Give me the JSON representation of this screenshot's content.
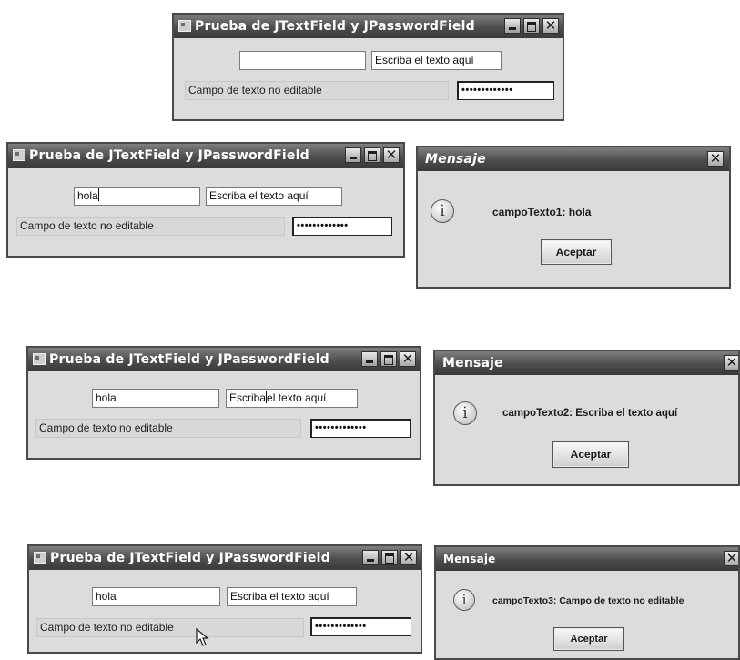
{
  "main_window": {
    "title": "Prueba de JTextField y JPasswordField",
    "empty_field": "",
    "hint_field": "Escriba el texto aquí",
    "noneditable_field": "Campo de texto no editable",
    "password_field": "•••••••••••••"
  },
  "window_2": {
    "title": "Prueba de JTextField y JPasswordField",
    "text_field": "hola",
    "hint_field": "Escriba el texto aquí",
    "noneditable_field": "Campo de texto no editable",
    "password_field": "•••••••••••••"
  },
  "dialog_1": {
    "title": "Mensaje",
    "info_icon": "i",
    "message": "campoTexto1: hola",
    "button": "Aceptar"
  },
  "window_3": {
    "title": "Prueba de JTextField y JPasswordField",
    "text_field": "hola",
    "hint_field_before_caret": "Escriba",
    "hint_field_after_caret": "el texto aquí",
    "noneditable_field": "Campo de texto no editable",
    "password_field": "•••••••••••••"
  },
  "dialog_2": {
    "title": "Mensaje",
    "info_icon": "i",
    "message": "campoTexto2: Escriba el texto aquí",
    "button": "Aceptar"
  },
  "window_4": {
    "title": "Prueba de JTextField y JPasswordField",
    "text_field": "hola",
    "hint_field": "Escriba el texto aquí",
    "noneditable_field": "Campo de texto no editable",
    "password_field": "•••••••••••••"
  },
  "dialog_3": {
    "title": "Mensaje",
    "info_icon": "i",
    "message": "campoTexto3: Campo de texto no editable",
    "button": "Aceptar"
  },
  "colors": {
    "titlebar": "#4d4d4d",
    "window_bg": "#dcdcdc",
    "field_bg": "#ffffff",
    "noneditable_bg": "#d8d8d8"
  }
}
